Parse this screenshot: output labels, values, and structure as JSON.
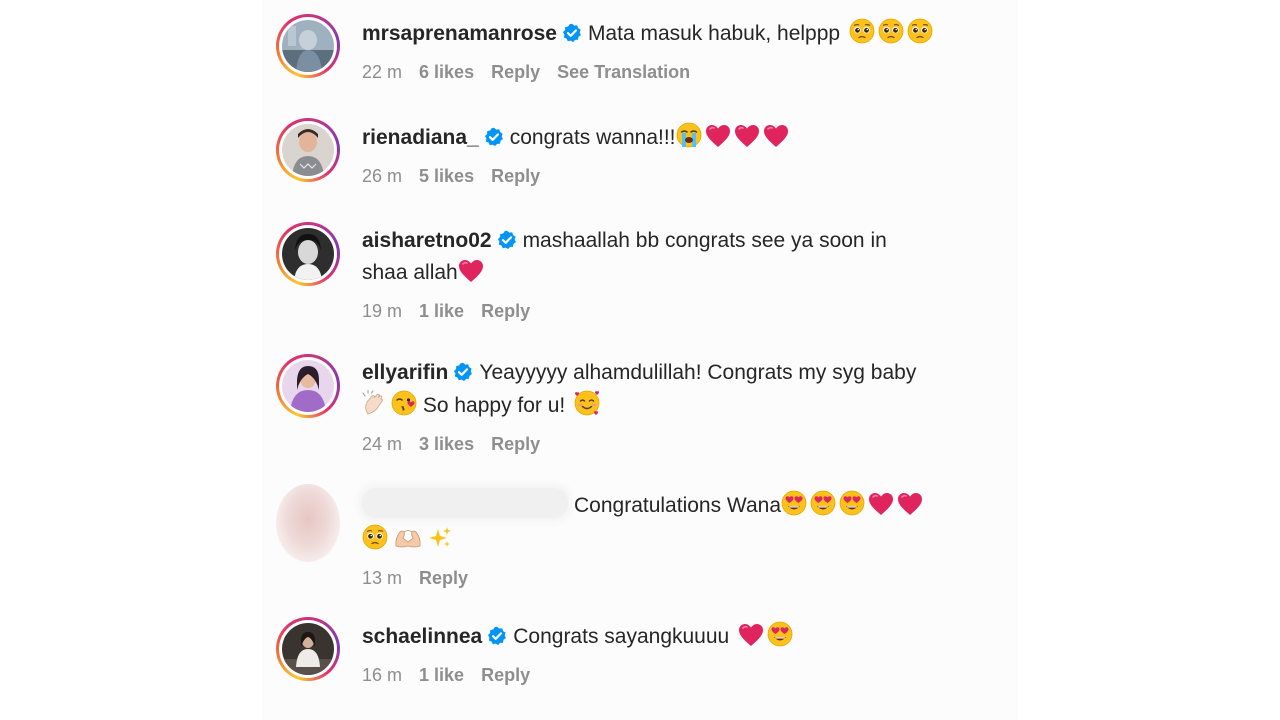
{
  "comments": [
    {
      "username": "mrsaprenamanrose",
      "verified": true,
      "text": "Mata masuk habuk, helppp",
      "emojis": [
        "pleading-face",
        "pleading-face",
        "pleading-face"
      ],
      "time": "22 m",
      "likes": "6 likes",
      "reply": "Reply",
      "translate": "See Translation"
    },
    {
      "username": "rienadiana_",
      "verified": true,
      "text": "congrats wanna!!!",
      "emojis": [
        "loudly-crying-face",
        "red-heart",
        "red-heart",
        "red-heart"
      ],
      "time": "26 m",
      "likes": "5 likes",
      "reply": "Reply"
    },
    {
      "username": "aisharetno02",
      "verified": true,
      "text_line1": "mashaallah bb congrats see ya soon in",
      "text_line2": "shaa allah",
      "emojis": [
        "red-heart"
      ],
      "time": "19 m",
      "likes": "1 like",
      "reply": "Reply"
    },
    {
      "username": "ellyarifin",
      "verified": true,
      "text_line1": "Yeayyyyy alhamdulillah! Congrats my syg baby",
      "text_line2": "So happy for u!",
      "emojis": [
        "clapping-hands",
        "face-blowing-kiss",
        "smiling-face-with-hearts"
      ],
      "time": "24 m",
      "likes": "3 likes",
      "reply": "Reply"
    },
    {
      "username": "",
      "verified": false,
      "text": "Congratulations Wana",
      "emojis": [
        "heart-eyes",
        "heart-eyes",
        "heart-eyes",
        "red-heart",
        "red-heart",
        "pleading-face",
        "heart-hands",
        "sparkles"
      ],
      "time": "13 m",
      "reply": "Reply"
    },
    {
      "username": "schaelinnea",
      "verified": true,
      "text": "Congrats sayangkuuuu",
      "emojis": [
        "red-heart",
        "heart-eyes"
      ],
      "time": "16 m",
      "likes": "1 like",
      "reply": "Reply"
    }
  ],
  "colors": {
    "text": "#262626",
    "meta": "#8e8e8e",
    "verified": "#0095f6",
    "heart": "#e0245e"
  }
}
